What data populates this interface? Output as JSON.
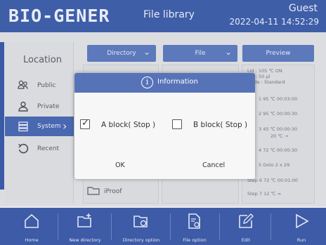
{
  "header": {
    "logo": "BIO-GENER",
    "title": "File library",
    "user": "Guest",
    "datetime": "2022-04-11 14:52:29"
  },
  "location": {
    "title": "Location",
    "items": [
      {
        "label": "Public",
        "icon": "users-icon"
      },
      {
        "label": "Private",
        "icon": "user-icon"
      },
      {
        "label": "System",
        "icon": "server-icon",
        "active": true
      },
      {
        "label": "Recent",
        "icon": "history-icon"
      }
    ]
  },
  "columns": {
    "directory": "Directory",
    "file": "File",
    "preview": "Preview"
  },
  "folder_item": "iProof",
  "preview_lines": [
    "Lid : 105 ℃ ON",
    "Vol : 50 µl",
    "Mode : Standard",
    "1  95 ℃ 00:03:00",
    "2  95 ℃ 00:00:30",
    "3  45 ℃ 00:00:30",
    "20 ℃ →",
    "4  72 ℃ 00:00:30",
    "5  Goto 2  x 29",
    "Step 6  72 ℃ 00:01:00",
    "Step 7  12 ℃ ∞"
  ],
  "dialog": {
    "title": "Information",
    "option_a": {
      "label": "A block( Stop )",
      "checked": true
    },
    "option_b": {
      "label": "B block( Stop )",
      "checked": false
    },
    "ok": "OK",
    "cancel": "Cancel"
  },
  "toolbar": {
    "items": [
      {
        "label": "Home",
        "icon": "home-icon"
      },
      {
        "label": "New directory",
        "icon": "new-folder-icon"
      },
      {
        "label": "Directory option",
        "icon": "folder-settings-icon"
      },
      {
        "label": "File option",
        "icon": "file-settings-icon"
      },
      {
        "label": "Edit",
        "icon": "edit-icon"
      },
      {
        "label": "Run",
        "icon": "play-icon"
      }
    ]
  },
  "colors": {
    "header": "#3f5ea8",
    "dialog_header": "#5773b8",
    "toolbar": "#3d5ba6",
    "active_item": "#4a68b0"
  }
}
